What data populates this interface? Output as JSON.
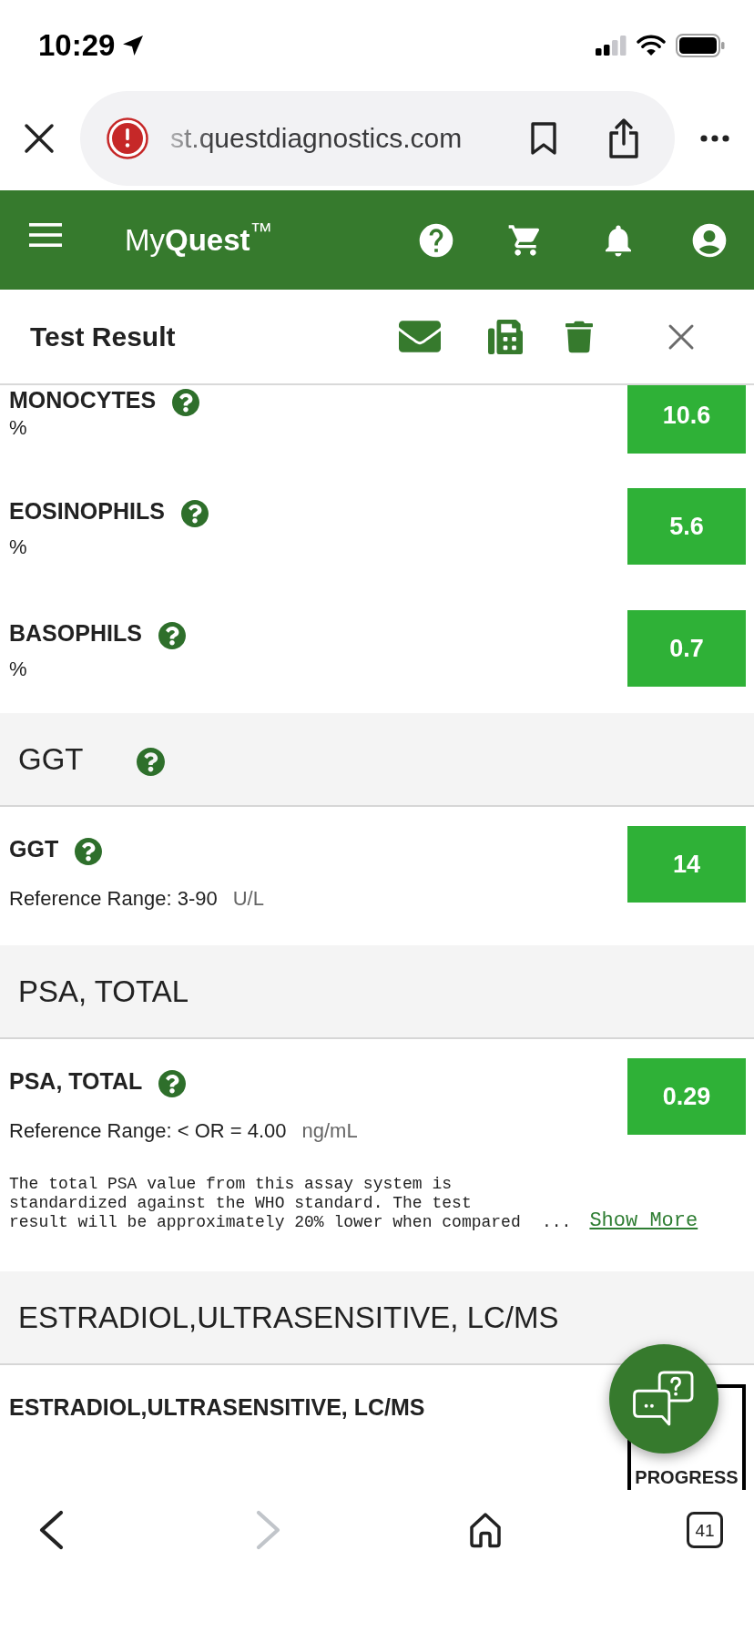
{
  "status_bar": {
    "time": "10:29"
  },
  "browser": {
    "url": "st.questdiagnostics.com"
  },
  "app_header": {
    "logo": "My**Quest**$^{™}$"
  },
  "page_header": {
    "title": "Test Result"
  },
  "results": [
    {
      "kind": "row",
      "name": "MONOCYTES",
      "help_icon": true,
      "unit": "%",
      "value": "10.6"
    },
    {
      "kind": "row",
      "name": "EOSINOPHILS",
      "help_icon": true,
      "unit": "%",
      "value": "5.6"
    },
    {
      "kind": "row",
      "name": "BASOPHILS",
      "help_icon": true,
      "unit": "%",
      "value": "0.7"
    },
    {
      "kind": "section",
      "title": "GGT",
      "help_icon": true
    },
    {
      "kind": "row",
      "name": "GGT",
      "help_icon": true,
      "reference_range": "Reference Range: 3-90",
      "unit": "U/L",
      "value": "14"
    },
    {
      "kind": "section",
      "title": "PSA, TOTAL",
      "help_icon": false
    },
    {
      "kind": "row",
      "name": "PSA, TOTAL",
      "help_icon": true,
      "reference_range": "Reference Range: < OR = 4.00",
      "unit": "ng/mL",
      "value": "0.29",
      "note": "The total PSA value from this assay system is standardized against the WHO standard. The test result will be approximately 20% lower when compared",
      "ellipsis": "...",
      "show_more": "Show More"
    },
    {
      "kind": "section",
      "title": "ESTRADIOL,ULTRASENSITIVE, LC/MS",
      "help_icon": false
    },
    {
      "kind": "row",
      "name": "ESTRADIOL,ULTRASENSITIVE, LC/MS",
      "help_icon": false,
      "status": "PROGRESS"
    }
  ],
  "bottom_bar": {
    "back_disabled": false,
    "forward_disabled": true,
    "tab_count": "41"
  }
}
